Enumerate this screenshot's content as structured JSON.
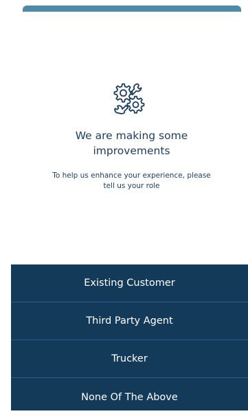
{
  "header": {
    "title": "We are making some",
    "title_line2": "improvements",
    "subtitle": "To help us enhance your experience, please",
    "subtitle_line2": "tell us your role",
    "icon": "gears-wrench-icon"
  },
  "roles": [
    {
      "label": "Existing Customer"
    },
    {
      "label": "Third Party Agent"
    },
    {
      "label": "Trucker"
    },
    {
      "label": "None Of The Above"
    }
  ],
  "colors": {
    "top_bar": "#4f8ba8",
    "button_bg": "#143a5a",
    "text": "#1d3d5c"
  }
}
